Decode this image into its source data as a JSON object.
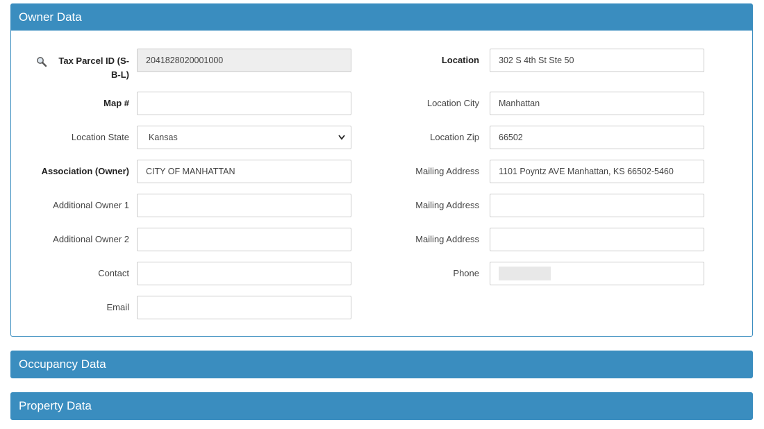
{
  "owner_panel": {
    "title": "Owner Data",
    "left": {
      "tax_parcel_label": "Tax Parcel ID (S-B-L)",
      "tax_parcel_value": "2041828020001000",
      "map_label": "Map #",
      "map_value": "",
      "location_state_label": "Location State",
      "location_state_value": "Kansas",
      "association_label": "Association (Owner)",
      "association_value": "CITY OF MANHATTAN",
      "additional_owner1_label": "Additional Owner 1",
      "additional_owner1_value": "",
      "additional_owner2_label": "Additional Owner 2",
      "additional_owner2_value": "",
      "contact_label": "Contact",
      "contact_value": "",
      "email_label": "Email",
      "email_value": ""
    },
    "right": {
      "location_label": "Location",
      "location_value": "302 S 4th St Ste 50",
      "location_city_label": "Location City",
      "location_city_value": "Manhattan",
      "location_zip_label": "Location Zip",
      "location_zip_value": "66502",
      "mailing_address1_label": "Mailing Address",
      "mailing_address1_value": "1101 Poyntz AVE Manhattan, KS 66502-5460",
      "mailing_address2_label": "Mailing Address",
      "mailing_address2_value": "",
      "mailing_address3_label": "Mailing Address",
      "mailing_address3_value": "",
      "phone_label": "Phone"
    }
  },
  "occupancy_panel": {
    "title": "Occupancy Data"
  },
  "property_panel": {
    "title": "Property Data"
  },
  "colors": {
    "accent": "#3a8dbf",
    "readonly_bg": "#eeeeee"
  },
  "icons": {
    "tax_parcel_search": "magnifier-icon",
    "select": "chevron-down-icon"
  }
}
